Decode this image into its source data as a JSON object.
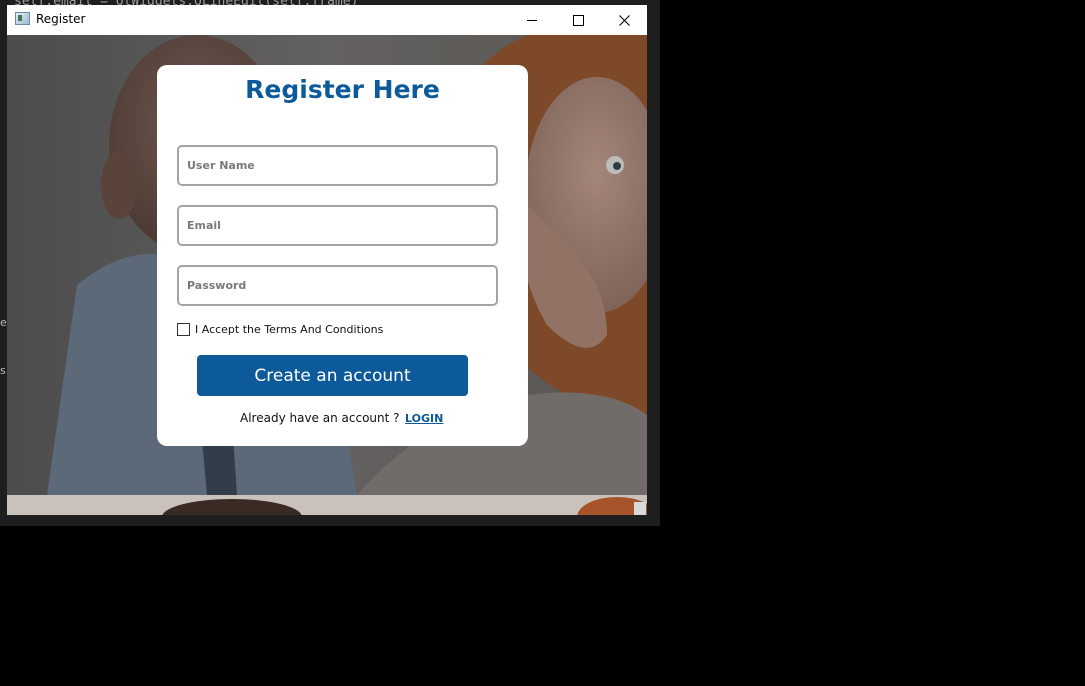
{
  "background": {
    "ide_code_line": "self.email = QtWidgets.QLineEdit(self.frame)",
    "side_text_1": "er",
    "side_text_2": "s"
  },
  "window": {
    "title": "Register",
    "icon": "app-window-icon",
    "controls": {
      "minimize_icon": "minimize-icon",
      "maximize_icon": "maximize-icon",
      "close_icon": "close-icon"
    }
  },
  "form": {
    "title": "Register Here",
    "username_placeholder": "User Name",
    "email_placeholder": "Email",
    "password_placeholder": "Password",
    "terms_label": "I Accept the Terms And Conditions",
    "terms_checked": false,
    "submit_label": "Create an account",
    "already_text": "Already have an account ?",
    "login_label": "LOGIN"
  },
  "colors": {
    "accent": "#0d5a9a",
    "card": "#ffffff",
    "field_border": "#a4a4a4"
  }
}
